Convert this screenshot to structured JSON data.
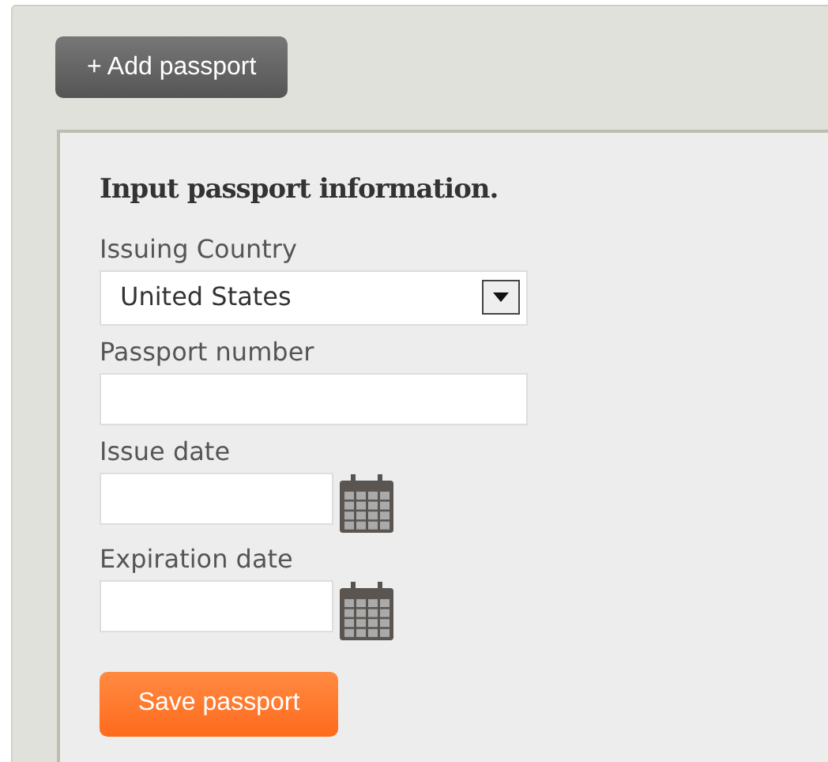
{
  "add_button": "+ Add passport",
  "form": {
    "heading": "Input passport information.",
    "fields": [
      {
        "kind": "select",
        "label": "Issuing Country",
        "value": "United States"
      },
      {
        "kind": "text",
        "label": "Passport number"
      },
      {
        "kind": "date",
        "label": "Issue date"
      },
      {
        "kind": "date",
        "label": "Expiration date"
      }
    ],
    "save_button": "Save passport"
  }
}
